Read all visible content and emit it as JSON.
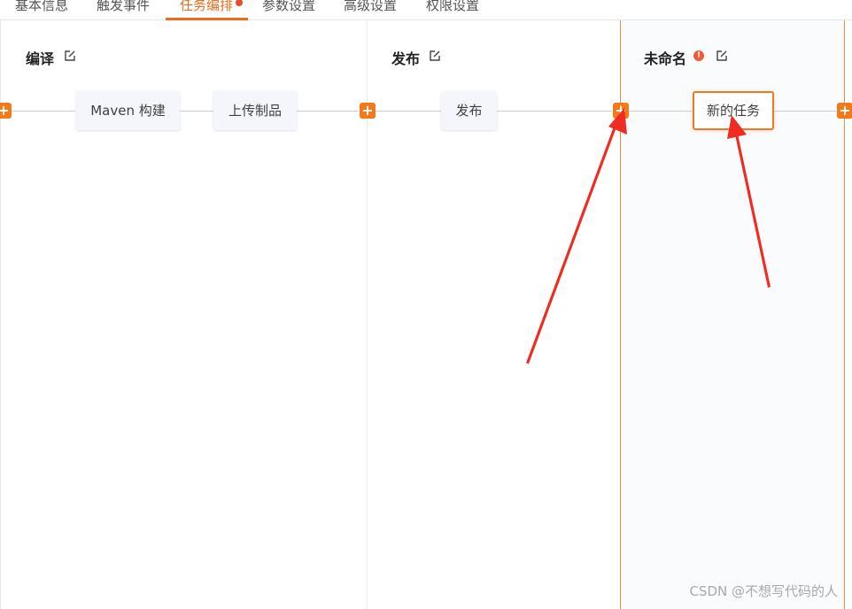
{
  "tabs": [
    {
      "label": "基本信息"
    },
    {
      "label": "触发事件"
    },
    {
      "label": "任务编排"
    },
    {
      "label": "参数设置"
    },
    {
      "label": "高级设置"
    },
    {
      "label": "权限设置"
    }
  ],
  "active_tab": "任务编排",
  "stages": [
    {
      "title": "编译",
      "tasks": [
        "Maven 构建",
        "上传制品"
      ]
    },
    {
      "title": "发布",
      "tasks": [
        "发布"
      ]
    },
    {
      "title": "未命名",
      "tasks": [
        "新的任务"
      ],
      "warning": "!"
    }
  ],
  "add_icon": "+",
  "colors": {
    "accent": "#ee6d1d",
    "arrow": "#ef2b22",
    "warning": "#ef5a36"
  },
  "watermark": "CSDN @不想写代码的人"
}
